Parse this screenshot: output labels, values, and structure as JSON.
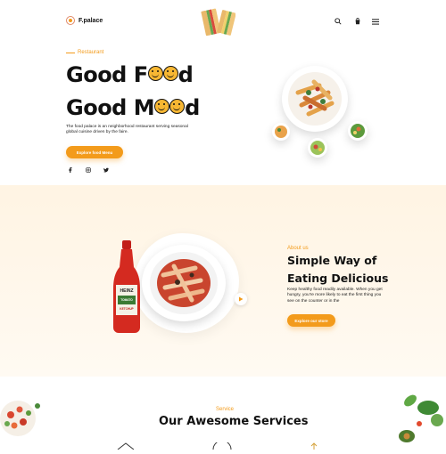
{
  "header": {
    "brand": "F.palace",
    "icons": [
      "search-icon",
      "cart-icon",
      "menu-icon"
    ]
  },
  "hero": {
    "tag": "Restaurant",
    "title_line1_a": "Good F",
    "title_line1_b": "d",
    "title_line2_a": "Good M",
    "title_line2_b": "d",
    "description": "The food palace is an neighborhood restaurant serving seasonal global cuisine driven by the faire.",
    "cta_label": "Explore food Menu",
    "social": [
      "facebook-icon",
      "instagram-icon",
      "twitter-icon"
    ]
  },
  "about": {
    "tag": "About us",
    "title_line1": "Simple Way of",
    "title_line2": "Eating Delicious",
    "description": "Keep healthy food readily available. When you get hungry, you're more likely to eat the first thing you see on the counter or in the",
    "cta_label": "Explore our store",
    "ketchup_label_1": "HEINZ",
    "ketchup_label_2": "TOMATO",
    "ketchup_label_3": "KETCHUP"
  },
  "services": {
    "tag": "Service",
    "title": "Our Awesome Services"
  },
  "colors": {
    "accent": "#f39b1b",
    "band": "#fff4e3"
  }
}
